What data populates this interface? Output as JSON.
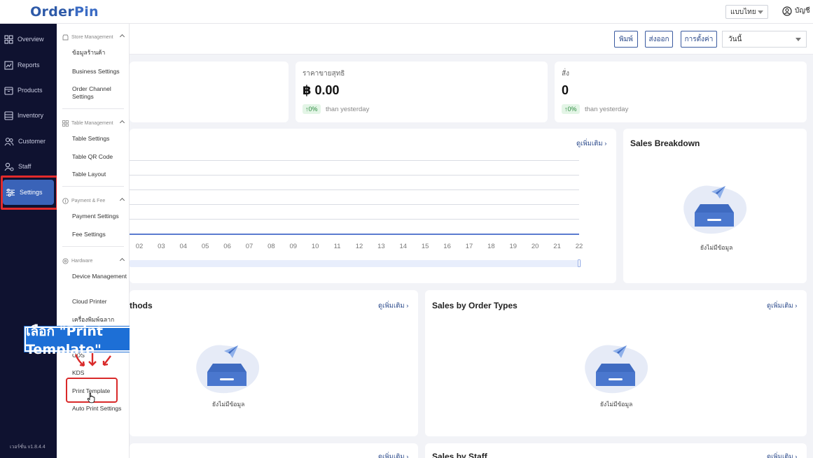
{
  "header": {
    "logo": "OrderPin",
    "language": "แบบไทย",
    "account": "บัญชี"
  },
  "rail": {
    "items": [
      {
        "label": "Overview",
        "icon": "grid-icon"
      },
      {
        "label": "Reports",
        "icon": "chart-icon"
      },
      {
        "label": "Products",
        "icon": "box-icon"
      },
      {
        "label": "Inventory",
        "icon": "archive-icon"
      },
      {
        "label": "Customer",
        "icon": "users-icon"
      },
      {
        "label": "Staff",
        "icon": "user-gear-icon"
      },
      {
        "label": "Settings",
        "icon": "sliders-icon"
      }
    ],
    "version": "เวอร์ชั่น v1.8.4.4"
  },
  "submenu": {
    "store_management": {
      "title": "Store Management",
      "items": [
        "ข้อมูลร้านค้า",
        "Business Settings",
        "Order Channel Settings"
      ]
    },
    "table_management": {
      "title": "Table Management",
      "items": [
        "Table Settings",
        "Table QR Code",
        "Table Layout"
      ]
    },
    "payment_fee": {
      "title": "Payment & Fee",
      "items": [
        "Payment Settings",
        "Fee Settings"
      ]
    },
    "hardware": {
      "title": "Hardware",
      "items": [
        "Device Management",
        "Cloud Printer",
        "เครื่องพิมพ์ฉลาก",
        "CDS",
        "KDS",
        "Print Template",
        "Auto Print Settings"
      ]
    }
  },
  "callout": {
    "text": "เลือก \"Print Template\""
  },
  "toolbar": {
    "print": "พิมพ์",
    "export": "ส่งออก",
    "settings": "การตั้งค่า",
    "date_range": "วันนี้"
  },
  "stats": {
    "net_sales": {
      "label": "ราคาขายสุทธิ",
      "value": "฿ 0.00",
      "change": "↑0%",
      "compare": "than yesterday"
    },
    "orders": {
      "label": "สั่ง",
      "value": "0",
      "change": "↑0%",
      "compare": "than yesterday"
    }
  },
  "sales_chart": {
    "more": "ดูเพิ่มเติม ›"
  },
  "chart_data": {
    "type": "line",
    "x": [
      "02",
      "03",
      "04",
      "05",
      "06",
      "07",
      "08",
      "09",
      "10",
      "11",
      "12",
      "13",
      "14",
      "15",
      "16",
      "17",
      "18",
      "19",
      "20",
      "21",
      "22"
    ],
    "series": [
      {
        "values": [
          0,
          0,
          0,
          0,
          0,
          0,
          0,
          0,
          0,
          0,
          0,
          0,
          0,
          0,
          0,
          0,
          0,
          0,
          0,
          0,
          0
        ]
      }
    ],
    "grid": true
  },
  "sales_breakdown": {
    "title": "Sales Breakdown",
    "empty": "ยังไม่มีข้อมูล"
  },
  "payment_methods": {
    "title": "thods",
    "more": "ดูเพิ่มเติม ›",
    "empty": "ยังไม่มีข้อมูล"
  },
  "order_types": {
    "title": "Sales by Order Types",
    "more": "ดูเพิ่มเติม ›",
    "empty": "ยังไม่มีข้อมูล"
  },
  "bottom_left": {
    "more": "ดูเพิ่มเติม ›"
  },
  "sales_staff": {
    "title": "Sales by Staff",
    "more": "ดูเพิ่มเติม ›"
  }
}
